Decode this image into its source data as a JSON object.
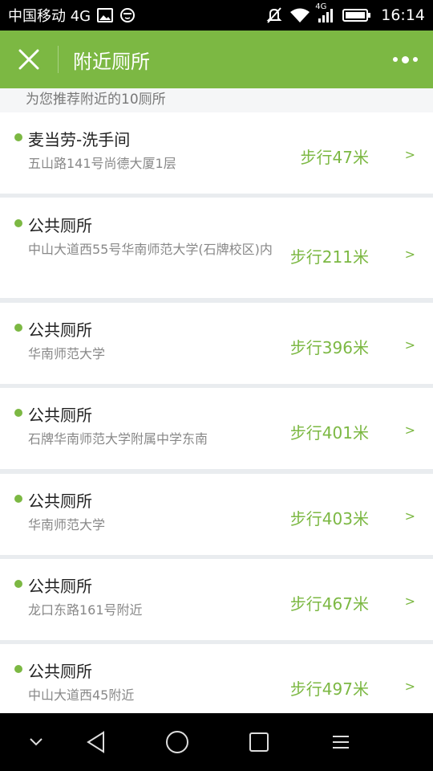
{
  "status_bar": {
    "carrier": "中国移动 4G",
    "network_label": "4G",
    "time": "16:14"
  },
  "header": {
    "title": "附近厕所"
  },
  "subtitle": "为您推荐附近的10厕所",
  "colors": {
    "accent": "#7cb843",
    "name_text": "#222222",
    "address_text": "#888888"
  },
  "items": [
    {
      "name": "麦当劳-洗手间",
      "address": "五山路141号尚德大厦1层",
      "distance": "步行47米",
      "arrow": ">"
    },
    {
      "name": "公共厕所",
      "address": "中山大道西55号华南师范大学(石牌校区)内",
      "distance": "步行211米",
      "arrow": ">"
    },
    {
      "name": "公共厕所",
      "address": "华南师范大学",
      "distance": "步行396米",
      "arrow": ">"
    },
    {
      "name": "公共厕所",
      "address": "石牌华南师范大学附属中学东南",
      "distance": "步行401米",
      "arrow": ">"
    },
    {
      "name": "公共厕所",
      "address": "华南师范大学",
      "distance": "步行403米",
      "arrow": ">"
    },
    {
      "name": "公共厕所",
      "address": "龙口东路161号附近",
      "distance": "步行467米",
      "arrow": ">"
    },
    {
      "name": "公共厕所",
      "address": "中山大道西45附近",
      "distance": "步行497米",
      "arrow": ">"
    }
  ],
  "nav_bar": {
    "icons": [
      "chevron-down-icon",
      "back-triangle-icon",
      "home-circle-icon",
      "recents-square-icon",
      "menu-icon"
    ]
  }
}
